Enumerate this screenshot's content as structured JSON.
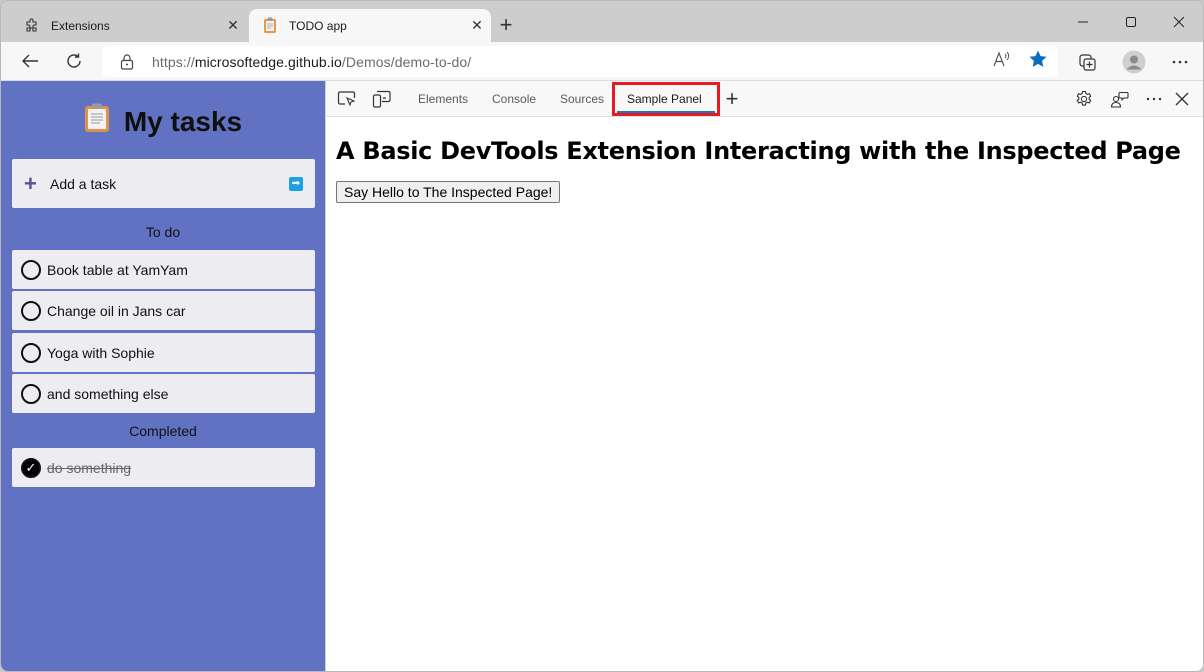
{
  "browser": {
    "tabs": [
      {
        "title": "Extensions",
        "icon": "extensions-puzzle-icon",
        "active": false
      },
      {
        "title": "TODO app",
        "icon": "clipboard-icon",
        "active": true
      }
    ],
    "new_tab_label": "+",
    "window_controls": {
      "minimize": "—",
      "maximize": "☐",
      "close": "✕"
    },
    "address": {
      "scheme": "https://",
      "host": "microsoftedge.github.io",
      "path": "/Demos/demo-to-do/"
    }
  },
  "todo": {
    "title": "My tasks",
    "add_task_label": "Add a task",
    "todo_section_label": "To do",
    "todo_items": [
      {
        "text": "Book table at YamYam",
        "done": false
      },
      {
        "text": "Change oil in Jans car",
        "done": false
      },
      {
        "text": "Yoga with Sophie",
        "done": false
      },
      {
        "text": "and something else",
        "done": false
      }
    ],
    "completed_section_label": "Completed",
    "completed_items": [
      {
        "text": "do something",
        "done": true
      }
    ]
  },
  "devtools": {
    "tabs": [
      {
        "label": "Elements",
        "active": false
      },
      {
        "label": "Console",
        "active": false
      },
      {
        "label": "Sources",
        "active": false
      },
      {
        "label": "Sample Panel",
        "active": true
      }
    ],
    "more_tabs_label": "+",
    "panel": {
      "heading": "A Basic DevTools Extension Interacting with the Inspected Page",
      "button_label": "Say Hello to The Inspected Page!"
    },
    "colors": {
      "highlight": "#e41b23",
      "active_underline": "#1a73c8"
    }
  },
  "colors": {
    "todo_background": "#6172c2",
    "task_background": "#ececf1",
    "favorite_star": "#0f6cbd"
  }
}
